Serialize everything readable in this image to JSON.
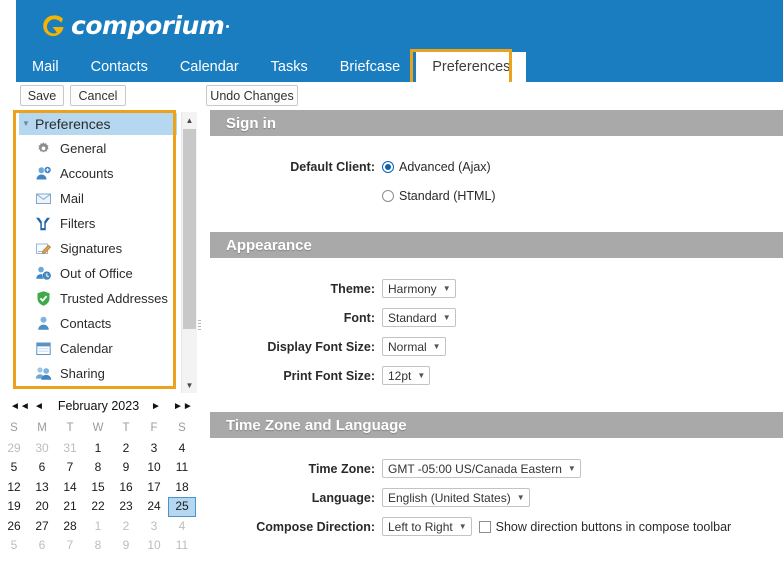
{
  "brand": {
    "name": "comporium",
    "logo_icon": "comporium-swoosh-logo",
    "bar_color": "#1a7dc0"
  },
  "nav": {
    "tabs": [
      {
        "label": "Mail",
        "active": false
      },
      {
        "label": "Contacts",
        "active": false
      },
      {
        "label": "Calendar",
        "active": false
      },
      {
        "label": "Tasks",
        "active": false
      },
      {
        "label": "Briefcase",
        "active": false
      },
      {
        "label": "Preferences",
        "active": true
      }
    ],
    "highlight_color": "#eda21b"
  },
  "toolbar": {
    "save_label": "Save",
    "cancel_label": "Cancel",
    "undo_label": "Undo Changes"
  },
  "sidebar": {
    "header": {
      "label": "Preferences",
      "caret_icon": "caret-down-icon"
    },
    "items": [
      {
        "label": "General",
        "icon": "gear-icon"
      },
      {
        "label": "Accounts",
        "icon": "person-add-icon"
      },
      {
        "label": "Mail",
        "icon": "envelope-icon"
      },
      {
        "label": "Filters",
        "icon": "filter-fork-icon"
      },
      {
        "label": "Signatures",
        "icon": "signature-pencil-icon"
      },
      {
        "label": "Out of Office",
        "icon": "clock-person-icon"
      },
      {
        "label": "Trusted Addresses",
        "icon": "shield-check-icon"
      },
      {
        "label": "Contacts",
        "icon": "person-icon"
      },
      {
        "label": "Calendar",
        "icon": "calendar-icon"
      },
      {
        "label": "Sharing",
        "icon": "people-share-icon"
      }
    ],
    "scrollbar": {
      "up_icon": "chevron-up-icon",
      "down_icon": "chevron-down-icon"
    },
    "highlight_color": "#eda21b"
  },
  "mini_calendar": {
    "title": "February 2023",
    "nav": {
      "fast_prev_icon": "double-chevron-left-icon",
      "prev_icon": "chevron-left-icon",
      "next_icon": "chevron-right-icon",
      "fast_next_icon": "double-chevron-right-icon"
    },
    "day_headers": [
      "S",
      "M",
      "T",
      "W",
      "T",
      "F",
      "S"
    ],
    "selected_day": 25,
    "weeks": [
      [
        {
          "d": "29",
          "o": true
        },
        {
          "d": "30",
          "o": true
        },
        {
          "d": "31",
          "o": true
        },
        {
          "d": "1"
        },
        {
          "d": "2"
        },
        {
          "d": "3"
        },
        {
          "d": "4"
        }
      ],
      [
        {
          "d": "5"
        },
        {
          "d": "6"
        },
        {
          "d": "7"
        },
        {
          "d": "8"
        },
        {
          "d": "9"
        },
        {
          "d": "10"
        },
        {
          "d": "11"
        }
      ],
      [
        {
          "d": "12"
        },
        {
          "d": "13"
        },
        {
          "d": "14"
        },
        {
          "d": "15"
        },
        {
          "d": "16"
        },
        {
          "d": "17"
        },
        {
          "d": "18"
        }
      ],
      [
        {
          "d": "19"
        },
        {
          "d": "20"
        },
        {
          "d": "21"
        },
        {
          "d": "22"
        },
        {
          "d": "23"
        },
        {
          "d": "24"
        },
        {
          "d": "25",
          "s": true
        }
      ],
      [
        {
          "d": "26"
        },
        {
          "d": "27"
        },
        {
          "d": "28"
        },
        {
          "d": "1",
          "o": true
        },
        {
          "d": "2",
          "o": true
        },
        {
          "d": "3",
          "o": true
        },
        {
          "d": "4",
          "o": true
        }
      ],
      [
        {
          "d": "5",
          "o": true
        },
        {
          "d": "6",
          "o": true
        },
        {
          "d": "7",
          "o": true
        },
        {
          "d": "8",
          "o": true
        },
        {
          "d": "9",
          "o": true
        },
        {
          "d": "10",
          "o": true
        },
        {
          "d": "11",
          "o": true
        }
      ]
    ]
  },
  "main": {
    "sections": {
      "signin": {
        "title": "Sign in",
        "default_client_label": "Default Client:",
        "options": [
          {
            "label": "Advanced (Ajax)",
            "selected": true
          },
          {
            "label": "Standard (HTML)",
            "selected": false
          }
        ]
      },
      "appearance": {
        "title": "Appearance",
        "theme_label": "Theme:",
        "theme_value": "Harmony",
        "font_label": "Font:",
        "font_value": "Standard",
        "display_font_size_label": "Display Font Size:",
        "display_font_size_value": "Normal",
        "print_font_size_label": "Print Font Size:",
        "print_font_size_value": "12pt"
      },
      "timezone": {
        "title": "Time Zone and Language",
        "time_zone_label": "Time Zone:",
        "time_zone_value": "GMT -05:00 US/Canada Eastern",
        "language_label": "Language:",
        "language_value": "English (United States)",
        "compose_direction_label": "Compose Direction:",
        "compose_direction_value": "Left to Right",
        "show_direction_buttons_label": "Show direction buttons in compose toolbar",
        "show_direction_buttons_checked": false
      }
    }
  }
}
